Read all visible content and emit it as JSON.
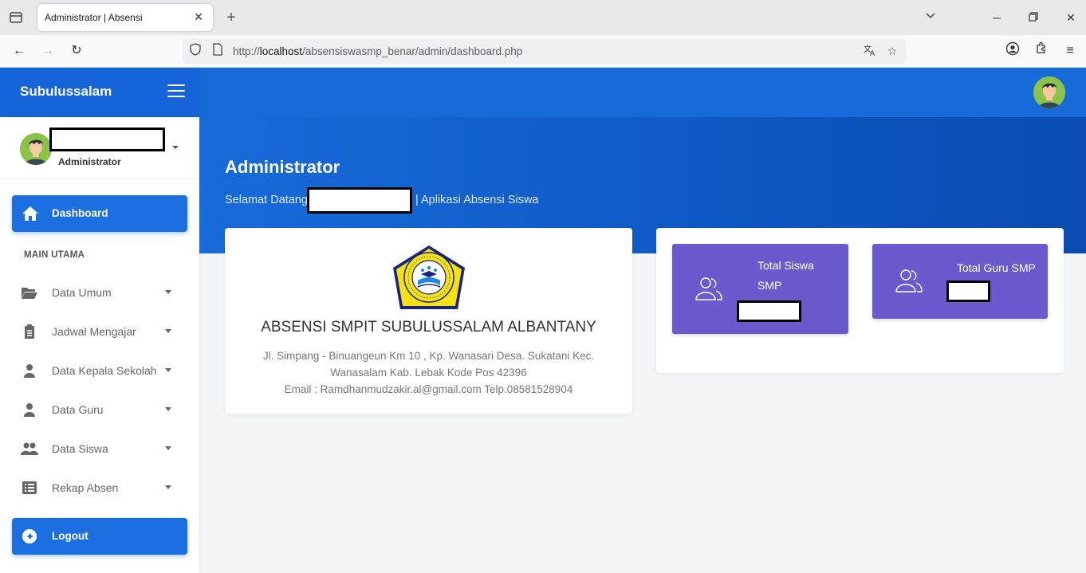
{
  "browser": {
    "tab_title": "Administrator | Absensi",
    "url_prefix": "http://",
    "url_host": "localhost",
    "url_path": "/absensiswasmp_benar/admin/dashboard.php"
  },
  "app": {
    "brand": "Subulussalam",
    "user_role": "Administrator"
  },
  "sidebar": {
    "active_item": "Dashboard",
    "section_title": "MAIN UTAMA",
    "items": [
      {
        "label": "Data Umum",
        "icon": "folder-open-icon"
      },
      {
        "label": "Jadwal Mengajar",
        "icon": "clipboard-icon"
      },
      {
        "label": "Data Kepala Sekolah",
        "icon": "user-icon"
      },
      {
        "label": "Data Guru",
        "icon": "user-icon"
      },
      {
        "label": "Data Siswa",
        "icon": "users-icon"
      },
      {
        "label": "Rekap Absen",
        "icon": "list-icon"
      }
    ],
    "logout": "Logout"
  },
  "hero": {
    "title": "Administrator",
    "welcome_prefix": "Selamat Datang,",
    "welcome_suffix": "| Aplikasi Absensi Siswa"
  },
  "school": {
    "name": "ABSENSI SMPIT SUBULUSSALAM ALBANTANY",
    "address_line1": "Jl. Simpang - Binuangeun Km 10 , Kp. Wanasari Desa. Sukatani Kec.",
    "address_line2": "Wanasalam Kab. Lebak Kode Pos 42396",
    "contact": "Email : Ramdhanmudzakir.al@gmail.com Telp.08581528904",
    "logo_text": "SUBULUSSALAM AL - BANTANY · DS. SUKATANI - KEC. WANASALAM - LEBAK"
  },
  "stats": {
    "siswa_line1": "Total Siswa",
    "siswa_line2": "SMP",
    "guru_label": "Total Guru SMP"
  },
  "colors": {
    "primary": "#1b6fe0",
    "topbar": "#176bd9",
    "stat_bg": "#6a5acd"
  }
}
